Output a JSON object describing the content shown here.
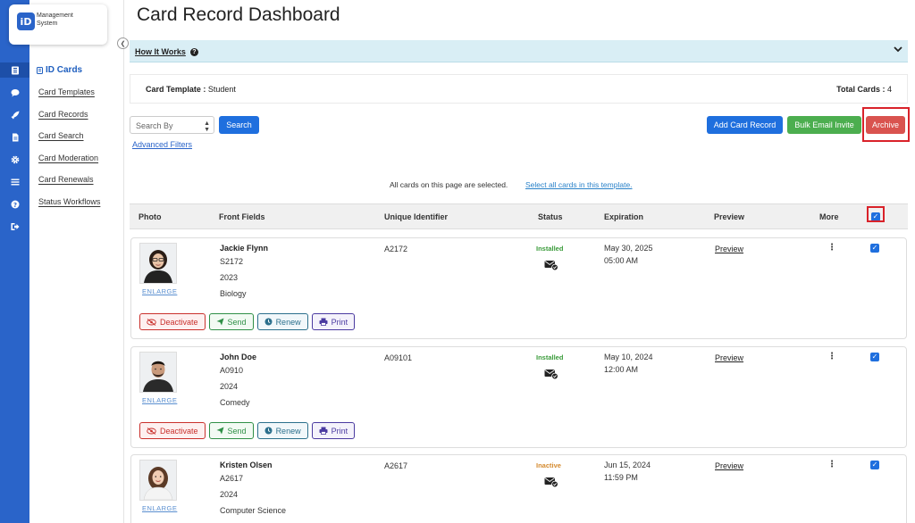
{
  "app": {
    "logo_mark": "iD",
    "logo_line1": "Management",
    "logo_line2": "System"
  },
  "rail_icons": [
    "id-card-icon",
    "chat-icon",
    "rocket-icon",
    "document-icon",
    "gear-icon",
    "list-icon",
    "help-icon",
    "sign-out-icon"
  ],
  "sidebar": {
    "heading": "ID Cards",
    "items": [
      {
        "label": "Card Templates"
      },
      {
        "label": "Card Records"
      },
      {
        "label": "Card Search"
      },
      {
        "label": "Card Moderation"
      },
      {
        "label": "Card Renewals"
      },
      {
        "label": "Status Workflows"
      }
    ]
  },
  "page": {
    "title": "Card Record Dashboard"
  },
  "how_it_works": {
    "label": "How It Works",
    "help_glyph": "?"
  },
  "template_bar": {
    "template_label": "Card Template :",
    "template_value": "Student",
    "total_label": "Total Cards :",
    "total_value": "4"
  },
  "toolbar": {
    "search_by_placeholder": "Search By",
    "search_label": "Search",
    "advanced_filters_label": "Advanced Filters",
    "add_label": "Add Card Record",
    "bulk_label": "Bulk Email Invite",
    "archive_label": "Archive"
  },
  "selection": {
    "message": "All cards on this page are selected.",
    "select_all_label": "Select all cards in this template."
  },
  "table": {
    "columns": [
      "Photo",
      "Front Fields",
      "Unique Identifier",
      "Status",
      "Expiration",
      "Preview",
      "More"
    ],
    "header_checkbox_checked": true
  },
  "actions": {
    "deactivate": "Deactivate",
    "send": "Send",
    "renew": "Renew",
    "print": "Print",
    "enlarge": "ENLARGE",
    "preview": "Preview"
  },
  "records": [
    {
      "name": "Jackie Flynn",
      "id_field": "S2172",
      "year": "2023",
      "major": "Biology",
      "uid": "A2172",
      "status": "Installed",
      "exp_date": "May 30, 2025",
      "exp_time": "05:00 AM",
      "checked": true
    },
    {
      "name": "John Doe",
      "id_field": "A0910",
      "year": "2024",
      "major": "Comedy",
      "uid": "A09101",
      "status": "Installed",
      "exp_date": "May 10, 2024",
      "exp_time": "12:00 AM",
      "checked": true
    },
    {
      "name": "Kristen Olsen",
      "id_field": "A2617",
      "year": "2024",
      "major": "Computer Science",
      "uid": "A2617",
      "status": "Inactive",
      "exp_date": "Jun 15, 2024",
      "exp_time": "11:59 PM",
      "checked": true
    }
  ],
  "colors": {
    "brand": "#2a64c9",
    "installed": "#3a9b3a",
    "inactive": "#d48a2e",
    "highlight": "#d9222a"
  }
}
